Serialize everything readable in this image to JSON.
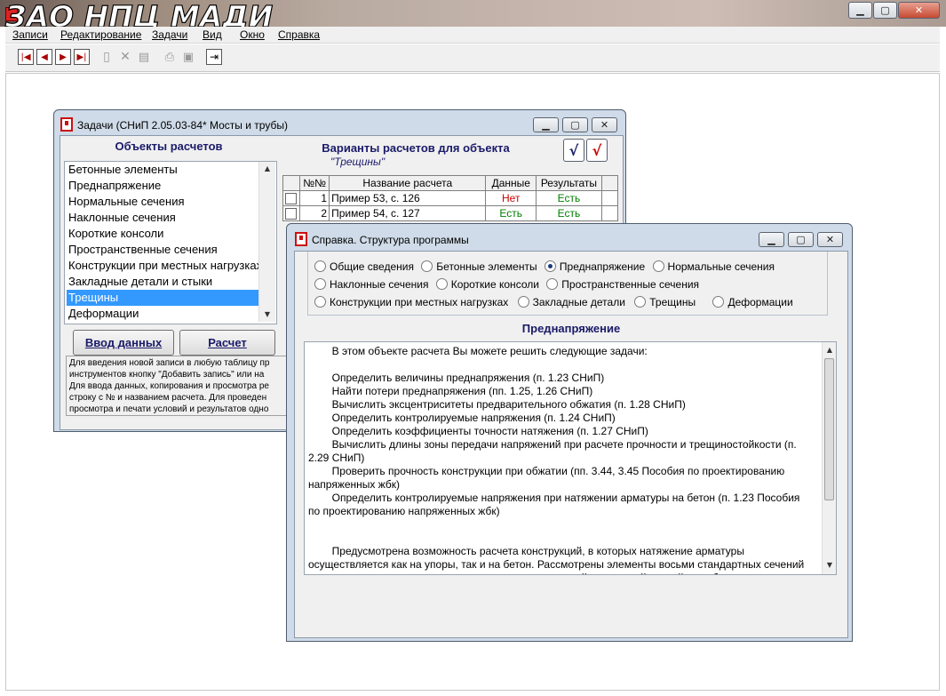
{
  "main": {
    "brand": "ЗАО НПЦ МАДИ",
    "menu": [
      "Записи",
      "Редактирование",
      "Задачи",
      "Вид",
      "Окно",
      "Справка"
    ]
  },
  "tasks_window": {
    "title": "Задачи (СНиП 2.05.03-84* Мосты и трубы)",
    "objects_header": "Объекты расчетов",
    "objects": [
      "Бетонные элементы",
      "Преднапряжение",
      "Нормальные сечения",
      "Наклонные сечения",
      "Короткие консоли",
      "Пространственные сечения",
      "Конструкции при местных нагрузках",
      "Закладные детали и стыки",
      "Трещины",
      "Деформации"
    ],
    "selected_object": "Трещины",
    "variants_header": "Варианты расчетов для объекта",
    "variants_subheader": "\"Трещины\"",
    "check_glyph": "√",
    "table": {
      "columns": [
        "№№",
        "Название расчета",
        "Данные",
        "Результаты"
      ],
      "rows": [
        {
          "num": "1",
          "name": "Пример 53, с. 126",
          "data": "Нет",
          "result": "Есть"
        },
        {
          "num": "2",
          "name": "Пример 54, с. 127",
          "data": "Есть",
          "result": "Есть"
        }
      ]
    },
    "buttons": {
      "input": "Ввод данных",
      "calc": "Расчет"
    },
    "hint": "Для введения новой записи в любую таблицу пр\nинструментов кнопку \"Добавить запись\" или на\nДля ввода данных, копирования и просмотра ре\nстроку с № и названием расчета. Для проведен\nпросмотра и печати условий и результатов одно"
  },
  "help_window": {
    "title": "Справка. Структура программы",
    "radios": [
      [
        "Общие сведения",
        "Бетонные элементы",
        "Преднапряжение",
        "Нормальные сечения"
      ],
      [
        "Наклонные сечения",
        "Короткие консоли",
        "Пространственные сечения"
      ],
      [
        "Конструкции при местных нагрузках",
        "Закладные детали",
        "Трещины",
        "Деформации"
      ]
    ],
    "selected_radio": "Преднапряжение",
    "section_title": "Преднапряжение",
    "text": "        В этом объекте расчета Вы можете решить следующие задачи:\n\n        Определить величины преднапряжения (п. 1.23 СНиП)\n        Найти потери преднапряжения (пп. 1.25, 1.26 СНиП)\n        Вычислить эксцентриситеты предварительного обжатия (п. 1.28 СНиП)\n        Определить контролируемые напряжения (п. 1.24 СНиП)\n        Определить коэффициенты точности натяжения (п. 1.27 СНиП)\n        Вычислить длины зоны передачи напряжений при расчете прочности и трещиностойкости (п.\n2.29 СНиП)\n        Проверить прочность конструкции при обжатии (пп. 3.44, 3.45 Пособия по проектированию\nнапряженных жбк)\n        Определить контролируемые напряжения при натяжении арматуры на бетон (п. 1.23 Пособия\nпо проектированию напряженных жбк)\n\n\n        Предусмотрена возможность расчета конструкций, в которых натяжение арматуры\nосуществляется как на упоры, так и на бетон. Рассмотрены элементы восьми стандартных сечений\n- прямоугольного, двутаврового, таврового с растянутой или сжатой полкой, коробчатого,"
  },
  "colors": {
    "accent": "#1a1a6a",
    "selection": "#3399ff",
    "no": "#cc0000",
    "yes": "#008000"
  }
}
